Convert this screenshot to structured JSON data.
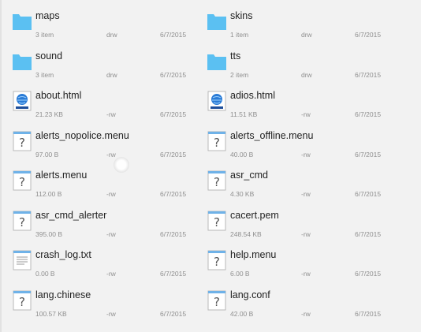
{
  "colors": {
    "folder": "#5bc0f2",
    "background": "#f2f2f2",
    "text": "#222222",
    "meta": "#8f8f8f"
  },
  "files": [
    {
      "name": "maps",
      "size": "3 item",
      "perm": "drw",
      "date": "6/7/2015",
      "icon": "folder-icon"
    },
    {
      "name": "skins",
      "size": "1 item",
      "perm": "drw",
      "date": "6/7/2015",
      "icon": "folder-icon"
    },
    {
      "name": "sound",
      "size": "3 item",
      "perm": "drw",
      "date": "6/7/2015",
      "icon": "folder-icon"
    },
    {
      "name": "tts",
      "size": "2 item",
      "perm": "drw",
      "date": "6/7/2015",
      "icon": "folder-icon"
    },
    {
      "name": "about.html",
      "size": "21.23 KB",
      "perm": "-rw",
      "date": "6/7/2015",
      "icon": "html-file-icon"
    },
    {
      "name": "adios.html",
      "size": "11.51 KB",
      "perm": "-rw",
      "date": "6/7/2015",
      "icon": "html-file-icon"
    },
    {
      "name": "alerts_nopolice.menu",
      "size": "97.00 B",
      "perm": "-rw",
      "date": "6/7/2015",
      "icon": "unknown-file-icon"
    },
    {
      "name": "alerts_offline.menu",
      "size": "40.00 B",
      "perm": "-rw",
      "date": "6/7/2015",
      "icon": "unknown-file-icon"
    },
    {
      "name": "alerts.menu",
      "size": "112.00 B",
      "perm": "-rw",
      "date": "6/7/2015",
      "icon": "unknown-file-icon"
    },
    {
      "name": "asr_cmd",
      "size": "4.30 KB",
      "perm": "-rw",
      "date": "6/7/2015",
      "icon": "unknown-file-icon"
    },
    {
      "name": "asr_cmd_alerter",
      "size": "395.00 B",
      "perm": "-rw",
      "date": "6/7/2015",
      "icon": "unknown-file-icon"
    },
    {
      "name": "cacert.pem",
      "size": "248.54 KB",
      "perm": "-rw",
      "date": "6/7/2015",
      "icon": "unknown-file-icon"
    },
    {
      "name": "crash_log.txt",
      "size": "0.00 B",
      "perm": "-rw",
      "date": "6/7/2015",
      "icon": "text-file-icon"
    },
    {
      "name": "help.menu",
      "size": "6.00 B",
      "perm": "-rw",
      "date": "6/7/2015",
      "icon": "unknown-file-icon"
    },
    {
      "name": "lang.chinese",
      "size": "100.57 KB",
      "perm": "-rw",
      "date": "6/7/2015",
      "icon": "unknown-file-icon"
    },
    {
      "name": "lang.conf",
      "size": "42.00 B",
      "perm": "-rw",
      "date": "6/7/2015",
      "icon": "unknown-file-icon"
    }
  ]
}
